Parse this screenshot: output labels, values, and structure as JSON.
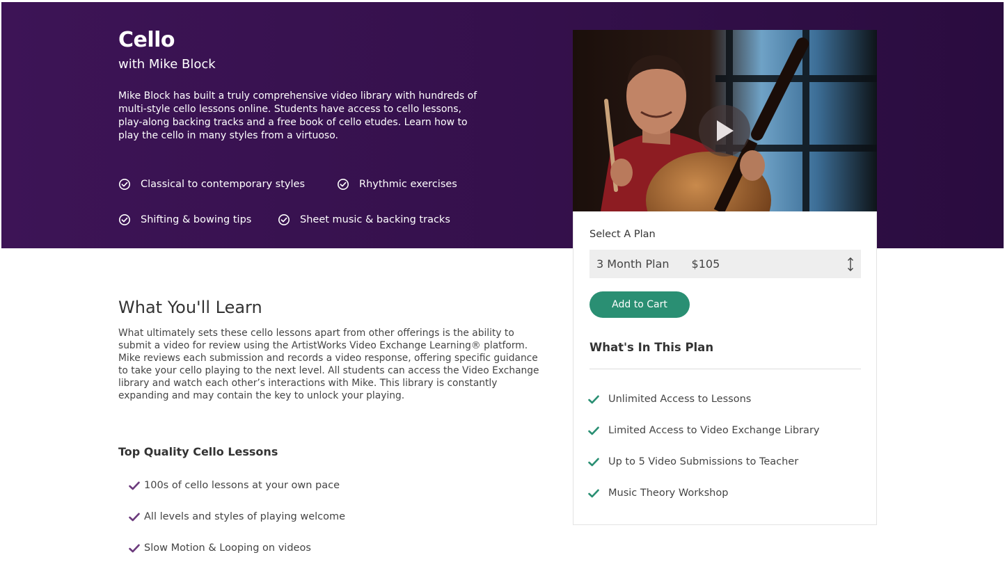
{
  "course": {
    "title": "Cello",
    "subtitle": "with Mike Block",
    "description": "Mike Block has built a truly comprehensive video library with hundreds of multi-style cello lessons online. Students have access to cello lessons, play-along backing tracks and a free book of cello etudes. Learn how to play the cello in many styles from a virtuoso.",
    "features": [
      "Classical to contemporary styles",
      "Rhythmic exercises",
      "Shifting & bowing tips",
      "Sheet music & backing tracks"
    ]
  },
  "video": {
    "play_icon": "play-icon"
  },
  "plan": {
    "select_label": "Select A Plan",
    "selected_plan": "3 Month Plan",
    "selected_price": "$105",
    "add_to_cart": "Add to Cart",
    "included_heading": "What's In This Plan",
    "included": [
      "Unlimited Access to Lessons",
      "Limited Access to Video Exchange Library",
      "Up to 5 Video Submissions to Teacher",
      "Music Theory Workshop"
    ]
  },
  "learn": {
    "heading": "What You'll Learn",
    "body": "What ultimately sets these cello lessons apart from other offerings is the ability to submit a video for review using the ArtistWorks Video Exchange Learning® platform. Mike reviews each submission and records a video response, offering specific guidance to take your cello playing to the next level. All students can access the Video Exchange library and watch each other’s interactions with Mike. This library is constantly expanding and may contain the key to unlock your playing."
  },
  "quality": {
    "heading": "Top Quality Cello Lessons",
    "items": [
      "100s of cello lessons at your own pace",
      "All levels and styles of playing welcome",
      "Slow Motion & Looping on videos"
    ]
  },
  "colors": {
    "hero_bg": "#34104b",
    "cart_button": "#2a8f73",
    "plan_check": "#2a8f73",
    "quality_check": "#6b3a7c"
  }
}
